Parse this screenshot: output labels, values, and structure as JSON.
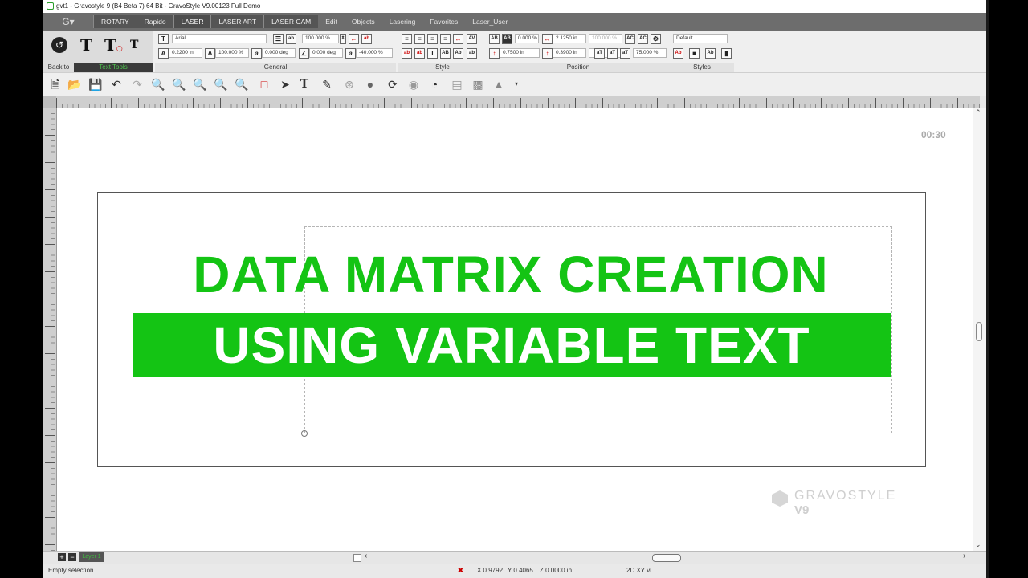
{
  "window": {
    "title": "gvt1 - Gravostyle 9 (B4 Beta 7) 64 Bit - GravoStyle V9.00123 Full Demo"
  },
  "menu": {
    "tabs": [
      "ROTARY",
      "Rapido",
      "LASER",
      "LASER ART",
      "LASER CAM"
    ],
    "items": [
      "Edit",
      "Objects",
      "Lasering",
      "Favorites",
      "Laser_User"
    ]
  },
  "ribbon": {
    "back_label": "Back to",
    "text_tools_label": "Text Tools",
    "font_name": "Arial",
    "char_height": "0.2200 in",
    "char_width_pct": "100.000 %",
    "scale_pct": "100.000 %",
    "angle": "0.000 deg",
    "slant": "0.000 deg",
    "spacing_pct": "-40.000 %",
    "kerning_pct": "0.000 %",
    "line_spacing": "0.7500 in",
    "pos_x": "2.1250 in",
    "pos_x_disabled": "100.000 %",
    "pos_y": "0.3900 in",
    "zoom_pct": "75.000 %",
    "style_default": "Default",
    "group_labels": {
      "general": "General",
      "style": "Style",
      "position": "Position",
      "styles": "Styles"
    }
  },
  "canvas": {
    "timer": "00:30",
    "headline": "DATA MATRIX CREATION",
    "subheadline": "USING VARIABLE TEXT",
    "watermark_brand": "GRAVOSTYLE",
    "watermark_version": "V9",
    "accent": "#14c414"
  },
  "layer": {
    "name": "Layer 1"
  },
  "status": {
    "selection": "Empty selection",
    "x": "X 0.9792",
    "y": "Y 0.4065",
    "z": "Z 0.0000 in",
    "view": "2D XY vi..."
  }
}
